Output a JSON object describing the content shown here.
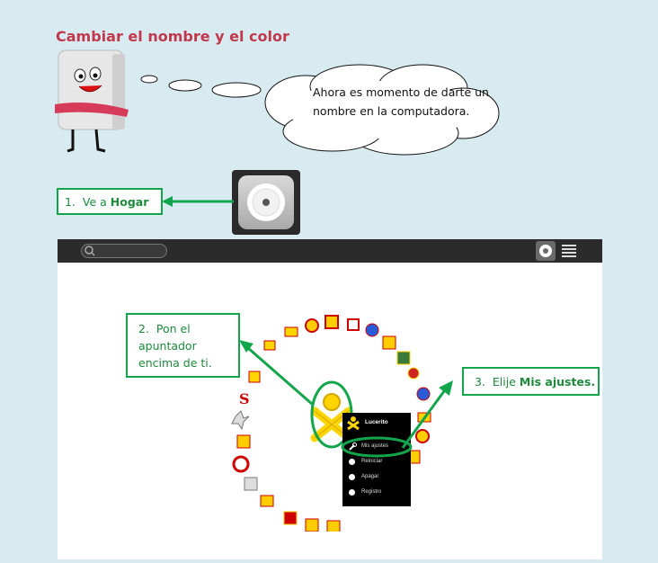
{
  "page": {
    "title": "Cambiar el nombre y el color"
  },
  "thought": {
    "text": "Ahora es momento de darte un nombre en la computadora."
  },
  "steps": {
    "step1": {
      "num": "1.",
      "text": "Ve a ",
      "bold": "Hogar"
    },
    "step2": {
      "num": "2.",
      "text": "Pon el apuntador encima de ti."
    },
    "step3": {
      "num": "3.",
      "text": "Elije ",
      "bold": "Mis ajustes."
    }
  },
  "menu": {
    "name": "Lucerito",
    "items": [
      "Mis ajustes",
      "Reiniciar",
      "Apagar",
      "Registro"
    ]
  },
  "colors": {
    "title": "#c1374c",
    "step_green": "#13a54b",
    "background": "#d8ebf1"
  },
  "icons": [
    "home-icon",
    "search-icon",
    "list-view-icon",
    "xo-user-icon",
    "wrench-icon",
    "restart-icon",
    "power-icon",
    "log-icon",
    "activity-icon"
  ]
}
